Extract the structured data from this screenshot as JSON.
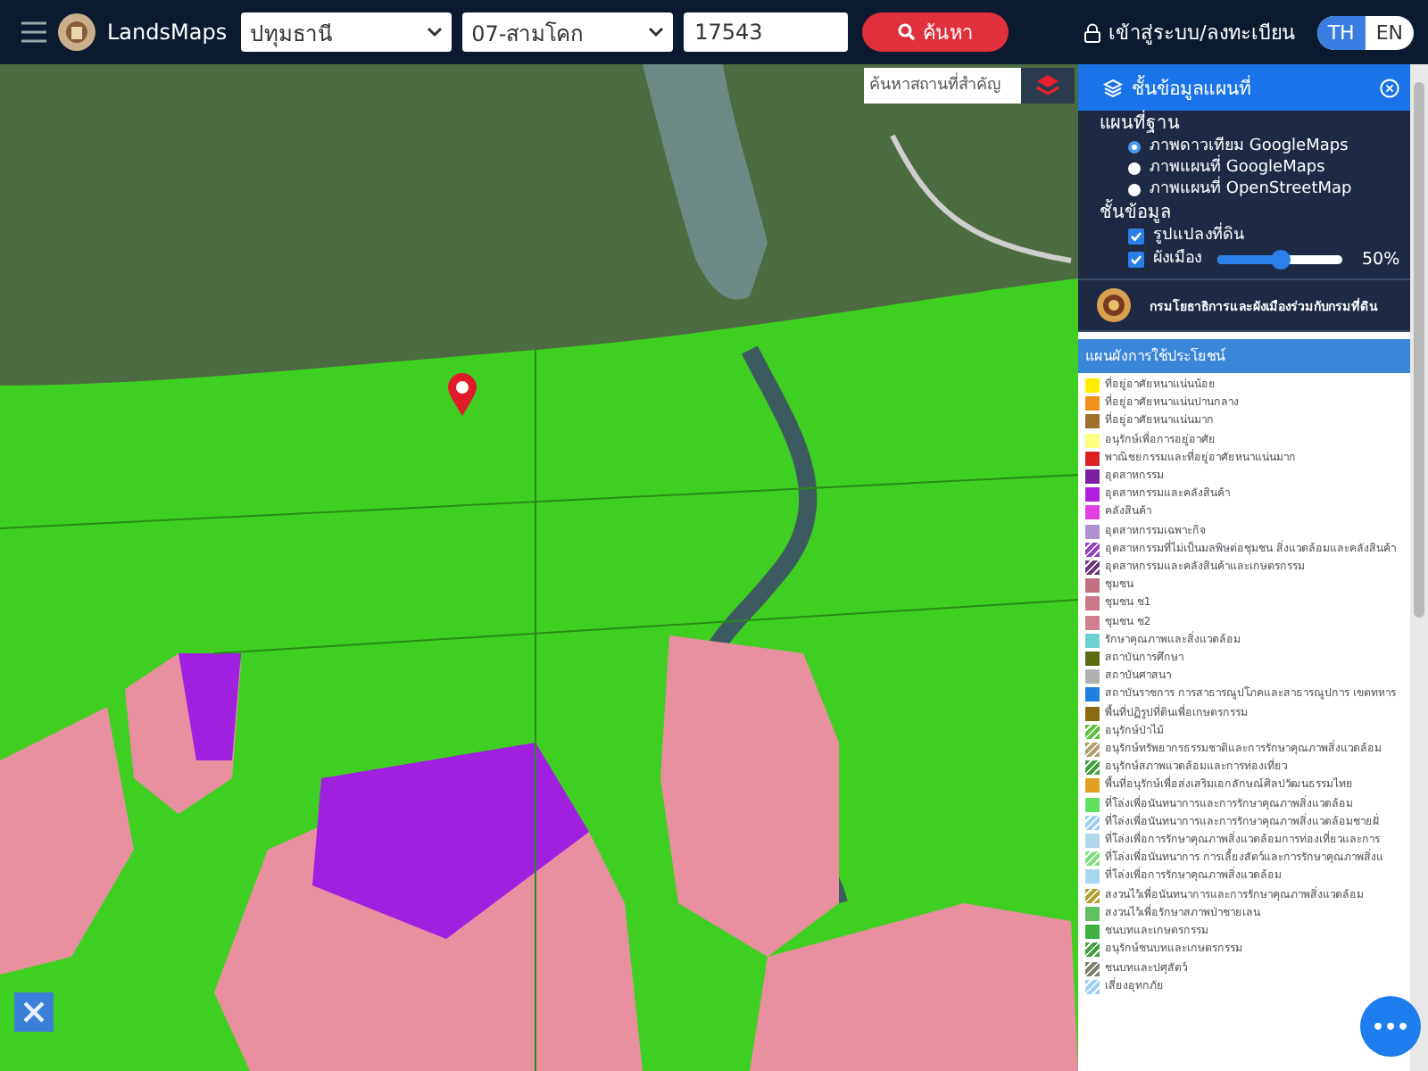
{
  "topbar": {
    "brand": "LandsMaps",
    "province": "ปทุมธานี",
    "district": "07-สามโคก",
    "parcel_number": "17543",
    "search_button": "ค้นหา",
    "login": "เข้าสู่ระบบ/ลงทะเบียน",
    "languages": [
      {
        "label": "TH",
        "selected": true
      },
      {
        "label": "EN",
        "selected": false
      }
    ]
  },
  "map": {
    "place_search": {
      "placeholder": "ค้นหาสถานที่สำคัญ"
    },
    "more_button": "•••"
  },
  "layer_panel": {
    "title": "ชั้นข้อมูลแผนที่",
    "basemap_heading": "แผนที่ฐาน",
    "basemaps": [
      {
        "label": "ภาพดาวเทียม GoogleMaps",
        "selected": true
      },
      {
        "label": "ภาพแผนที่ GoogleMaps",
        "selected": false
      },
      {
        "label": "ภาพแผนที่ OpenStreetMap",
        "selected": false
      }
    ],
    "layers_heading": "ชั้นข้อมูล",
    "layers": [
      {
        "kind": "checkbox",
        "label": "รูปแปลงที่ดิน",
        "checked": true
      },
      {
        "kind": "slider",
        "label": "ผังเมือง",
        "checked": true,
        "level": 0.5,
        "reading": "50%"
      }
    ],
    "banner": "กรมโยธาธิการและผังเมืองร่วมกับกรมที่ดิน",
    "legend_heading": "แผนผังการใช้ประโยชน์",
    "legend": [
      {
        "label": "ที่อยู่อาศัยหนาแน่นน้อย",
        "color": "#ffee00",
        "kind": "solid"
      },
      {
        "label": "ที่อยู่อาศัยหนาแน่นปานกลาง",
        "color": "#f0901c",
        "kind": "solid"
      },
      {
        "label": "ที่อยู่อาศัยหนาแน่นมาก",
        "color": "#a0702a",
        "kind": "solid"
      },
      {
        "label": "อนุรักษ์เพื่อการอยู่อาศัย",
        "color": "#ffff80",
        "kind": "solid"
      },
      {
        "label": "พาณิชยกรรมและที่อยู่อาศัยหนาแน่นมาก",
        "color": "#e02020",
        "kind": "solid"
      },
      {
        "label": "อุตสาหกรรม",
        "color": "#7a1fa2",
        "kind": "solid"
      },
      {
        "label": "อุตสาหกรรมและคลังสินค้า",
        "color": "#b020e0",
        "kind": "solid"
      },
      {
        "label": "คลังสินค้า",
        "color": "#e040e0",
        "kind": "solid"
      },
      {
        "label": "อุตสาหกรรมเฉพาะกิจ",
        "color": "#b090d0",
        "kind": "solid"
      },
      {
        "label": "อุตสาหกรรมที่ไม่เป็นมลพิษต่อชุมชน สิ่งแวดล้อมและคลังสินค้า",
        "color": "#9040c0",
        "kind": "hatched"
      },
      {
        "label": "อุตสาหกรรมและคลังสินค้าและเกษตรกรรม",
        "color": "#6a3a7a",
        "kind": "hatched"
      },
      {
        "label": "ชุมชน",
        "color": "#c07080",
        "kind": "solid"
      },
      {
        "label": "ชุมชน ช1",
        "color": "#c87888",
        "kind": "solid"
      },
      {
        "label": "ชุมชน ช2",
        "color": "#d08090",
        "kind": "solid"
      },
      {
        "label": "รักษาคุณภาพและสิ่งแวดล้อม",
        "color": "#70d0d0",
        "kind": "solid"
      },
      {
        "label": "สถาบันการศึกษา",
        "color": "#5a6a10",
        "kind": "solid"
      },
      {
        "label": "สถาบันศาสนา",
        "color": "#b0b0b0",
        "kind": "solid"
      },
      {
        "label": "สถาบันราชการ การสาธารณูปโภคและสาธารณูปการ เขตทหาร",
        "color": "#2080e0",
        "kind": "solid"
      },
      {
        "label": "พื้นที่ปฏิรูปที่ดินเพื่อเกษตรกรรม",
        "color": "#8a6a10",
        "kind": "solid"
      },
      {
        "label": "อนุรักษ์ป่าไม้",
        "color": "#60c040",
        "kind": "hatched"
      },
      {
        "label": "อนุรักษ์ทรัพยากรธรรมชาติและการรักษาคุณภาพสิ่งแวดล้อม",
        "color": "#b0a070",
        "kind": "hatched"
      },
      {
        "label": "อนุรักษ์สภาพแวดล้อมและการท่องเที่ยว",
        "color": "#40a040",
        "kind": "hatched"
      },
      {
        "label": "พื้นที่อนุรักษ์เพื่อส่งเสริมเอกลักษณ์ศิลปวัฒนธรรมไทย",
        "color": "#e0a020",
        "kind": "solid"
      },
      {
        "label": "ที่โล่งเพื่อนันทนาการและการรักษาคุณภาพสิ่งแวดล้อม",
        "color": "#60e060",
        "kind": "solid"
      },
      {
        "label": "ที่โล่งเพื่อนันทนาการและการรักษาคุณภาพสิ่งแวดล้อมชายฝั่",
        "color": "#a0d0f0",
        "kind": "hatched"
      },
      {
        "label": "ที่โล่งเพื่อการรักษาคุณภาพสิ่งแวดล้อมการท่องเที่ยวและการ",
        "color": "#b0d8e8",
        "kind": "solid"
      },
      {
        "label": "ที่โล่งเพื่อนันทนาการ การเลี้ยงสัตว์และการรักษาคุณภาพสิ่งแ",
        "color": "#80e080",
        "kind": "hatched"
      },
      {
        "label": "ที่โล่งเพื่อการรักษาคุณภาพสิ่งแวดล้อม",
        "color": "#a8d8f0",
        "kind": "solid"
      },
      {
        "label": "สงวนไว้เพื่อนันทนาการและการรักษาคุณภาพสิ่งแวดล้อม",
        "color": "#b0a030",
        "kind": "hatched"
      },
      {
        "label": "สงวนไว้เพื่อรักษาสภาพป่าชายเลน",
        "color": "#60c060",
        "kind": "solid"
      },
      {
        "label": "ชนบทและเกษตรกรรม",
        "color": "#40b040",
        "kind": "solid"
      },
      {
        "label": "อนุรักษ์ชนบทและเกษตรกรรม",
        "color": "#40a040",
        "kind": "hatched"
      },
      {
        "label": "ชนบทและปศุสัตว์",
        "color": "#808070",
        "kind": "hatched"
      },
      {
        "label": "เสี่ยงอุทกภัย",
        "color": "#a0d0f0",
        "kind": "hatched"
      }
    ]
  }
}
